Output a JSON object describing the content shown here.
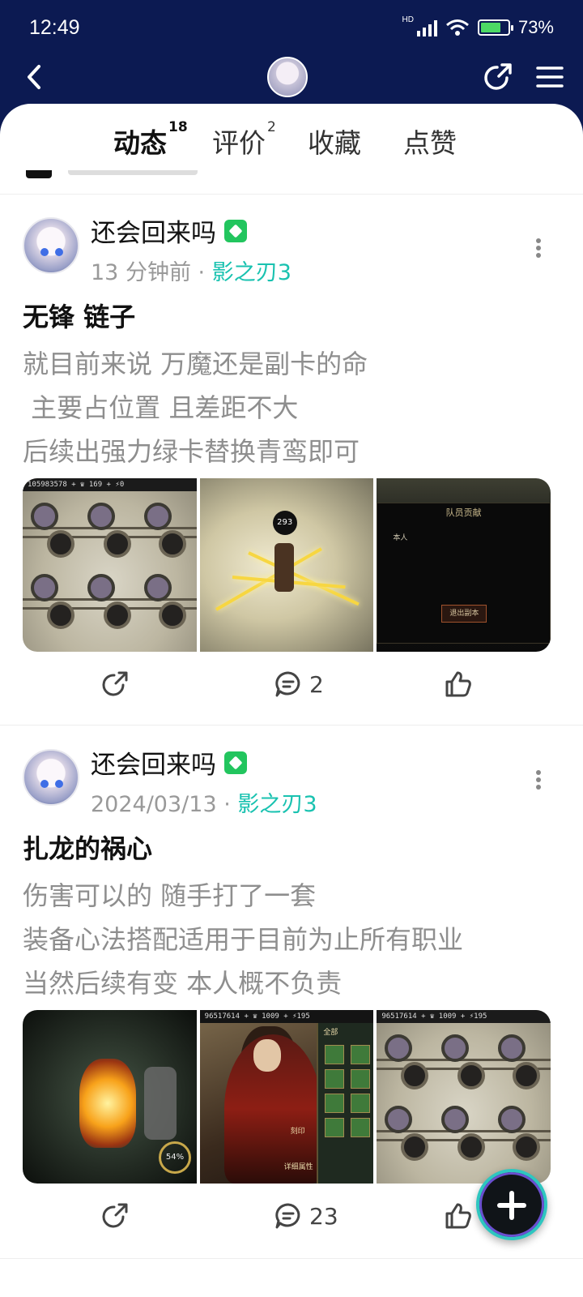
{
  "status_bar": {
    "time": "12:49",
    "network": "HD",
    "battery": "73%"
  },
  "header": {
    "icons": [
      "back-icon",
      "avatar",
      "share-icon",
      "menu-icon"
    ]
  },
  "tabs": [
    {
      "label": "动态",
      "count": "18",
      "active": true
    },
    {
      "label": "评价",
      "count": "2",
      "active": false
    },
    {
      "label": "收藏",
      "count": "",
      "active": false
    },
    {
      "label": "点赞",
      "count": "",
      "active": false
    }
  ],
  "posts": [
    {
      "author": "还会回来吗",
      "time": "13 分钟前",
      "separator": "·",
      "game": "影之刃3",
      "title": "无锋 链子",
      "lines": [
        "就目前来说 万魔还是副卡的命",
        " 主要占位置 且差距不大",
        "后续出强力绿卡替换青鸾即可"
      ],
      "image_captions": [
        "105983578",
        "169",
        "0",
        "293",
        "队员贡献",
        "本人",
        "退出副本"
      ],
      "actions": {
        "share": "",
        "comments": "2",
        "likes": ""
      }
    },
    {
      "author": "还会回来吗",
      "time": "2024/03/13",
      "separator": "·",
      "game": "影之刃3",
      "title": "扎龙的祸心",
      "lines": [
        "伤害可以的 随手打了一套",
        "装备心法搭配适用于目前为止所有职业",
        "当然后续有变 本人概不负责"
      ],
      "image_captions": [
        "96517614",
        "1009",
        "195",
        "刻印",
        "详细属性",
        "全部",
        "54%"
      ],
      "actions": {
        "share": "",
        "comments": "23",
        "likes": ""
      }
    }
  ],
  "fab": {
    "icon": "plus-icon"
  },
  "colors": {
    "header_bg": "#0c1a52",
    "accent": "#19c2b0",
    "tab_underline": "#1fd0b6",
    "badge": "#22c55e"
  }
}
